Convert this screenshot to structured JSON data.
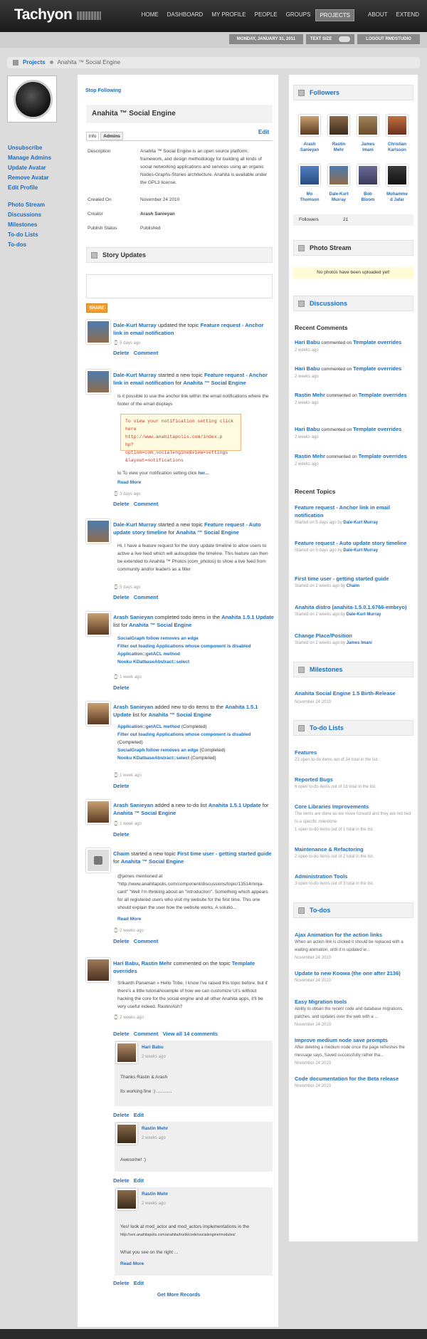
{
  "app": {
    "logo": "Tachyon"
  },
  "nav": [
    "HOME",
    "DASHBOARD",
    "MY PROFILE",
    "PEOPLE",
    "GROUPS",
    "PROJECTS",
    "ABOUT",
    "EXTEND"
  ],
  "subbar": {
    "date": "MONDAY, JANUARY 31, 2011",
    "textsize": "TEXT SIZE",
    "logout": "LOGOUT RMDSTUDIO"
  },
  "breadcrumb": {
    "parent": "Projects",
    "current": "Anahita ™ Social Engine"
  },
  "leftmenu": {
    "a": [
      "Unsubscribe",
      "Manage Admins",
      "Update Avatar",
      "Remove Avatar",
      "Edit Profile"
    ],
    "b": [
      "Photo Stream",
      "Discussions",
      "Milestones",
      "To-do Lists",
      "To-dos"
    ]
  },
  "main": {
    "stop": "Stop Following",
    "title": "Anahita ™ Social Engine",
    "edit": "Edit",
    "tabs": [
      "Info",
      "Admins"
    ],
    "info": {
      "desc_label": "Description",
      "desc": "Anahita ™ Social Engine is an open source platform, framework, and design methodology for building all kinds of social networking applications and services using an organic Nodes-Graphs-Stories architecture. Anahita is available under the GPL3 license.",
      "created_label": "Created On",
      "created": "November 24 2010",
      "creator_label": "Creator",
      "creator": "Arash Sanieyan",
      "status_label": "Publish Status",
      "status": "Published"
    },
    "updates": "Story Updates",
    "share": "SHARE",
    "more": "Get More Records",
    "delete": "Delete",
    "comment": "Comment",
    "editl": "Edit",
    "readmore": "Read More"
  },
  "stories": [
    {
      "a": "Dale-Kurt Murray",
      "v": "updated the topic",
      "t": "Feature request - Anchor link in email notification",
      "time": "5 days ago"
    },
    {
      "a": "Dale-Kurt Murray",
      "v": "started a new topic",
      "t": "Feature request - Anchor link in email notification",
      "f": "for",
      "p": "Anahita ™ Social Engine",
      "q": "Is it possible to use the anchor link within the email notifications where the footer of the email displays",
      "code": [
        "To view your notification setting click",
        "here http://www.anahitapolis.com/index.p",
        "hp?option=com_socialengine&view=settings",
        "&layout=notifications"
      ],
      "q2": "to To view your notification setting click",
      "q2l": "her...",
      "time": "3 days ago"
    },
    {
      "a": "Dale-Kurt Murray",
      "v": "started a new topic",
      "t": "Feature request - Auto update story timeline",
      "f": "for",
      "p": "Anahita ™ Social Engine",
      "q": "Hi, I have a feature request for the story update timeline to allow users to active a live feed which will autoupdate the timeline. This feature can then be extended to Anahita ™ Photos (com_photos) to show a live feed from community and/or leaders as a filter",
      "time": "5 days ago"
    },
    {
      "a": "Arash Sanieyan",
      "v": "completed todo items in the",
      "t": "Anahita 1.5.1 Update",
      "f": "list for",
      "p": "Anahita ™ Social Engine",
      "items": [
        "SocialGraph follow removes an edge",
        "Filter out loading Applications whose component is disabled",
        "Application::getACL method",
        "Nooku KDatbaseAbstract::select"
      ],
      "time": "1 week ago"
    },
    {
      "a": "Arash Sanieyan",
      "v": "added new to-do items to the",
      "t": "Anahita 1.5.1 Update",
      "f": "list for",
      "p": "Anahita ™ Social Engine",
      "items": [
        "Application::getACL method",
        "Filter out loading Applications whose component is disabled",
        "SocialGraph follow removes an edge",
        "Nooku KDatbaseAbstract::select"
      ],
      "completed": "(Completed)",
      "time": "1 week ago"
    },
    {
      "a": "Arash Sanieyan",
      "v": "added a new to-do list",
      "t": "Anahita 1.5.1 Update",
      "f": "for",
      "p": "Anahita ™ Social Engine",
      "time": "1 week ago"
    },
    {
      "a": "Chaim",
      "v": "started a new topic",
      "t": "First time user - getting started guide",
      "f": "for",
      "p": "Anahita ™ Social Engine",
      "q": "@james mentioned at \"http://www.anahitapolis.com/component/discussions/topic/13514/ninja-card\" \"Well I'm thinking about an \"introduction\". Something which appears for all registered users who visit my website for the first time. This one should explain the user how the website works. A solutio...",
      "time": "2 weeks ago"
    },
    {
      "a": "Hari Babu, Rastin Mehr",
      "v": "commented on the topic",
      "t": "Template overrides",
      "q": "Srikanth Panaman » Hello Tribe, I know I've raised this topic before, but if there's a little tutorial/example of how we can customize UI's without hacking the core for the social engine and all other Anahita apps, it'll be very useful indeed. Rastin/Ash?",
      "time": "2 weeks ago",
      "viewall": "View all 14 comments",
      "comments": [
        {
          "n": "Hari Babu",
          "time": "2 weeks ago",
          "l1": "Thanks Rastin & Arash",
          "l2": "Its working fine :) ............"
        },
        {
          "n": "Rastin Mehr",
          "time": "2 weeks ago",
          "l1": "Awesome! :)"
        },
        {
          "n": "Rastin Mehr",
          "time": "2 weeks ago",
          "l1": "Yes! look at mod_actor and mod_actors implementations in the",
          "l2": "http://svn.anahitapolis.com/anahita/trunk/code/socialengine/modules/",
          "l3": "What you see on the right ..."
        }
      ]
    }
  ],
  "side": {
    "followers": "Followers",
    "fnames": [
      [
        "Arash",
        "Sanieyan"
      ],
      [
        "Rastin",
        "Mehr"
      ],
      [
        "James",
        "Imani"
      ],
      [
        "Christian",
        "Karlsson"
      ],
      [
        "Mo",
        "Thomson"
      ],
      [
        "Dale-Kurt",
        "Murray"
      ],
      [
        "Bob",
        "Bloom"
      ],
      [
        "Mohamme",
        "d Jafar"
      ]
    ],
    "fcount_label": "Followers",
    "fcount": "21",
    "photostream": "Photo Stream",
    "nophotos": "No photos have been uploaded yet!",
    "discussions": "Discussions",
    "recent_comments": "Recent Comments",
    "comments": [
      {
        "a": "Hari Babu",
        "t": "Template overrides"
      },
      {
        "a": "Hari Babu",
        "t": "Template overrides"
      },
      {
        "a": "Rastin Mehr",
        "t": "Template overrides"
      },
      {
        "a": "Hari Babu",
        "t": "Template overrides"
      },
      {
        "a": "Rastin Mehr",
        "t": "Template overrides"
      }
    ],
    "commented_on": "commented on",
    "ago2": "2 weeks ago",
    "recent_topics": "Recent Topics",
    "topics": [
      {
        "t": "Feature request - Anchor link in email notification",
        "s": "Started on 5 days ago by",
        "a": "Dale-Kurt Murray"
      },
      {
        "t": "Feature request - Auto update story timeline",
        "s": "Started on 5 days ago by",
        "a": "Dale-Kurt Murray"
      },
      {
        "t": "First time user - getting started guide",
        "s": "Started on 2 weeks ago by",
        "a": "Chaim"
      },
      {
        "t": "Anahita distro (anahita-1.5.0.1.6766-embryo)",
        "s": "Started on 2 weeks ago by",
        "a": "Dale-Kurt Murray"
      },
      {
        "t": "Change Place/Position",
        "s": "Started on 2 weeks ago by",
        "a": "James Imani"
      }
    ],
    "milestones": "Milestones",
    "milestone": "Anahita Social Engine 1.5 Birth-Release",
    "mdate": "November 24 2010",
    "todolists": "To-do Lists",
    "lists": [
      {
        "t": "Features",
        "d": "23 open to-do items out of 34 total in the list."
      },
      {
        "t": "Reported Bugs",
        "d": "6 open to-do items out of 18 total in the list."
      },
      {
        "t": "Core Libraries Improvements",
        "d": "The items are done as we move forward and they are not tied to a specific milestone.",
        "d2": "1 open to-do items out of 1 total in the list."
      },
      {
        "t": "Maintenance & Refactoring",
        "d": "2 open to-do items out of 2 total in the list."
      },
      {
        "t": "Administration Tools",
        "d": "3 open to-do items out of 3 total in the list."
      }
    ],
    "todos": "To-dos",
    "todoitems": [
      {
        "t": "Ajax Animation for the action links",
        "d": "When an action link is clicked it should be replaced with a waiting animation, until it is updated w...",
        "dt": "November 24 2010"
      },
      {
        "t": "Update to new Koowa (the one after 2136)",
        "dt": "November 24 2010"
      },
      {
        "t": "Easy Migration tools",
        "d": "Ability to obtain the recent code and database migrations, patches, and updates over the web with a ...",
        "dt": "November 24 2010"
      },
      {
        "t": "Improve medium node save prompts",
        "d": "After deleting a medium node once the page refreshes the message says, Saved successfully rather tha...",
        "dt": "November 24 2010"
      },
      {
        "t": "Code documentation for the Beta release",
        "dt": "November 24 2010"
      }
    ]
  }
}
